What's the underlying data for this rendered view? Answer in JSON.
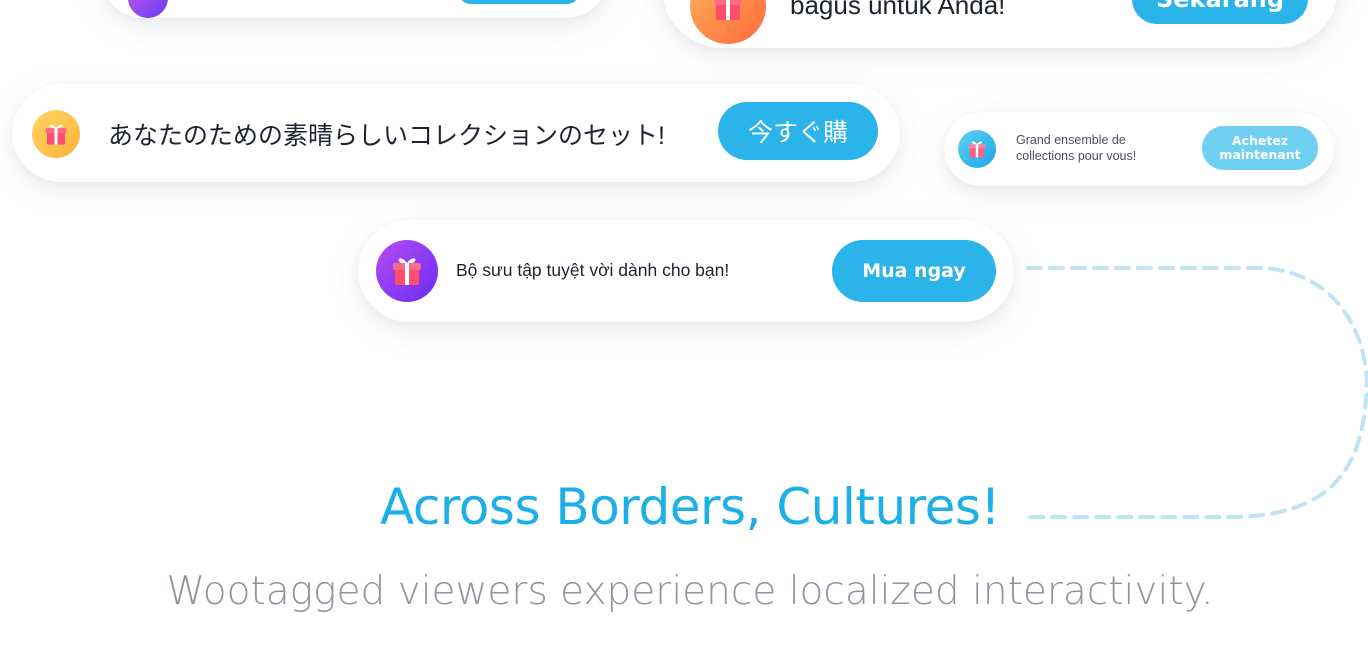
{
  "cards": {
    "top_left": {
      "button_label": ""
    },
    "indonesian": {
      "message": "bagus untuk Anda!",
      "button_label": "Sekarang"
    },
    "japanese": {
      "message": "あなたのための素晴らしいコレクションのセット!",
      "button_label": "今すぐ購"
    },
    "french": {
      "message": "Grand ensemble de collections pour vous!",
      "button_label": "Achetez maintenant"
    },
    "vietnamese": {
      "message": "Bộ sưu tập tuyệt vời dành cho bạn!",
      "button_label": "Mua ngay"
    }
  },
  "headline": "Across Borders, Cultures!",
  "subheadline": "Wootagged viewers experience localized interactivity.",
  "colors": {
    "accent": "#1db0e8",
    "button": "#2ab4ea",
    "subtext": "#8f93a3",
    "dashed_line": "#bfe4f3"
  },
  "icons": {
    "gift": "gift-icon"
  }
}
